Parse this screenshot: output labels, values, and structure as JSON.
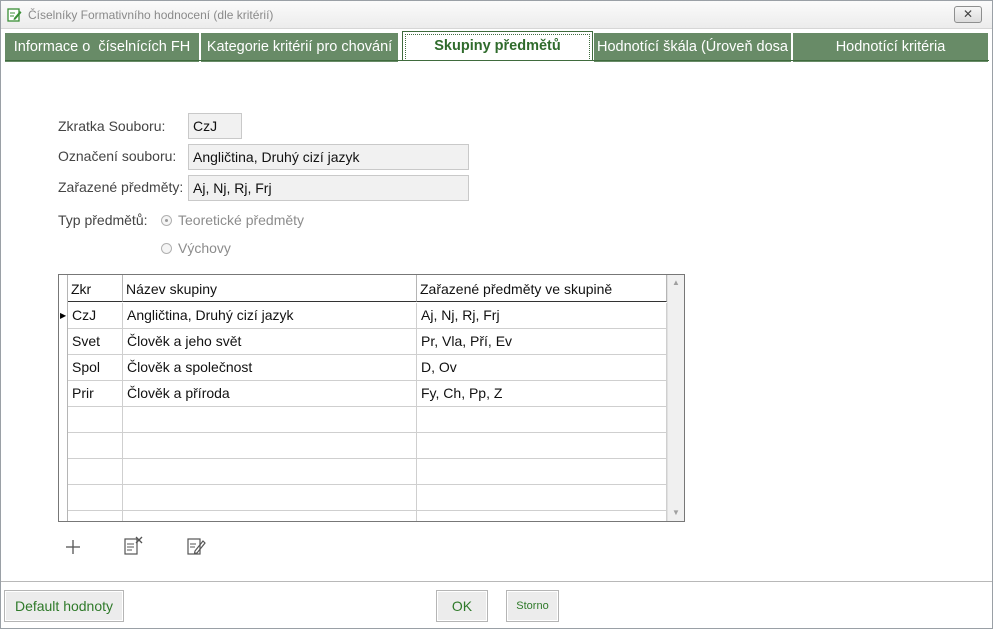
{
  "window": {
    "title": "Číselníky Formativního hodnocení (dle kritérií)",
    "close_label": "✕"
  },
  "tabs": [
    {
      "label": "Informace o  číselnících FH",
      "active": false
    },
    {
      "label": "Kategorie kritérií pro chování",
      "active": false
    },
    {
      "label": "Skupiny předmětů",
      "active": true
    },
    {
      "label": "Hodnotící škála (Úroveň dosa",
      "active": false
    },
    {
      "label": "Hodnotící kritéria",
      "active": false
    }
  ],
  "form": {
    "abbr_label": "Zkratka Souboru:",
    "abbr_value": "CzJ",
    "name_label": "Označení souboru:",
    "name_value": "Angličtina, Druhý cizí jazyk",
    "subjects_label": "Zařazené předměty:",
    "subjects_value": "Aj, Nj, Rj, Frj",
    "type_label": "Typ předmětů:",
    "type_options": [
      "Teoretické předměty",
      "Výchovy"
    ],
    "type_selected": "Teoretické předměty"
  },
  "grid": {
    "columns": [
      "Zkr",
      "Název skupiny",
      "Zařazené předměty ve skupině"
    ],
    "rows": [
      [
        "CzJ",
        "Angličtina, Druhý cizí jazyk",
        "Aj, Nj, Rj, Frj"
      ],
      [
        "Svet",
        "Člověk a jeho svět",
        "Pr, Vla, Pří, Ev"
      ],
      [
        "Spol",
        "Člověk a společnost",
        "D, Ov"
      ],
      [
        "Prir",
        "Člověk a příroda",
        "Fy, Ch, Pp, Z"
      ]
    ],
    "selected_row": 0,
    "row_marker": "▶"
  },
  "toolbar": {
    "icons": [
      "add-icon",
      "delete-record-icon",
      "edit-record-icon"
    ]
  },
  "footer": {
    "default_label": "Default hodnoty",
    "ok_label": "OK",
    "cancel_label": "Storno"
  },
  "colors": {
    "tab_bg": "#688b67",
    "accent_green": "#2f7a2a"
  }
}
